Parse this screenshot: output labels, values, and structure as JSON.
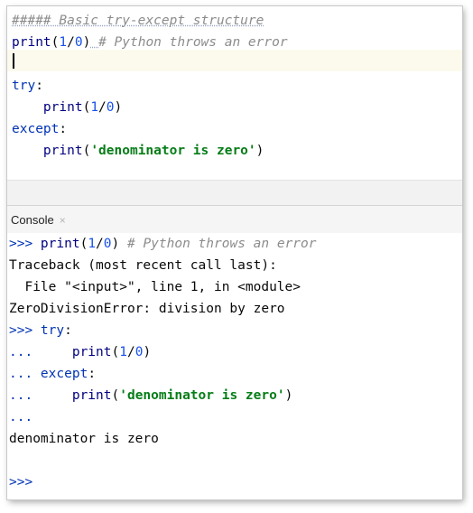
{
  "editor": {
    "lines": [
      {
        "comment": "##### Basic try-except structure"
      },
      {
        "fn": "print",
        "open": "(",
        "num1": "1",
        "slash": "/",
        "num2": "0",
        "close": ")",
        "sp": " ",
        "comment": "# Python throws an error"
      },
      {},
      {
        "kw": "try",
        "punct": ":"
      },
      {
        "indent": "    ",
        "fn": "print",
        "open": "(",
        "num1": "1",
        "slash": "/",
        "num2": "0",
        "close": ")"
      },
      {
        "kw": "except",
        "punct": ":"
      },
      {
        "indent": "    ",
        "fn": "print",
        "open": "(",
        "str": "'denominator is zero'",
        "close": ")"
      }
    ]
  },
  "console_tab": {
    "label": "Console",
    "close": "×"
  },
  "console": {
    "l1": {
      "prompt": ">>> ",
      "fn": "print",
      "open": "(",
      "num1": "1",
      "slash": "/",
      "num2": "0",
      "close": ")",
      "sp": " ",
      "comment": "# Python throws an error"
    },
    "l2": "Traceback (most recent call last):",
    "l3": "  File \"<input>\", line 1, in <module>",
    "l4": "ZeroDivisionError: division by zero",
    "l5": {
      "prompt": ">>> ",
      "kw": "try",
      "punct": ":"
    },
    "l6": {
      "prompt": "...     ",
      "fn": "print",
      "open": "(",
      "num1": "1",
      "slash": "/",
      "num2": "0",
      "close": ")"
    },
    "l7": {
      "prompt": "... ",
      "kw": "except",
      "punct": ":"
    },
    "l8": {
      "prompt": "...     ",
      "fn": "print",
      "open": "(",
      "str": "'denominator is zero'",
      "close": ")"
    },
    "l9": {
      "prompt": "..."
    },
    "l10": "denominator is zero",
    "l12": {
      "prompt": ">>>"
    }
  },
  "colors": {
    "keyword": "#0033b3",
    "function": "#000080",
    "number": "#1750eb",
    "string": "#067d17",
    "comment": "#8c8c8c",
    "error": "#8c1c1c",
    "current_line": "#fcfaed"
  }
}
